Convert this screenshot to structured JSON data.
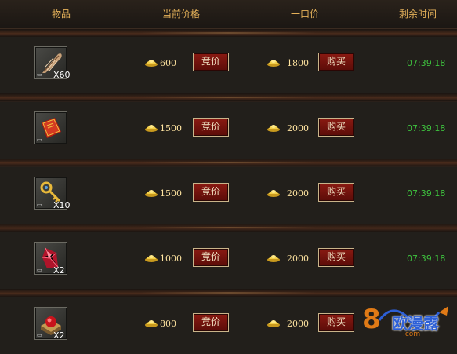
{
  "header": {
    "item": "物品",
    "current_price": "当前价格",
    "buyout_price": "一口价",
    "time_left": "剩余时间"
  },
  "buttons": {
    "bid": "竞价",
    "buy": "购买"
  },
  "rows": [
    {
      "icon": "feather-icon",
      "qty": "X60",
      "current_price": "600",
      "buyout_price": "1800",
      "time_left": "07:39:18"
    },
    {
      "icon": "red-book-icon",
      "qty": "",
      "current_price": "1500",
      "buyout_price": "2000",
      "time_left": "07:39:18"
    },
    {
      "icon": "golden-key-icon",
      "qty": "X10",
      "current_price": "1500",
      "buyout_price": "2000",
      "time_left": "07:39:18"
    },
    {
      "icon": "red-crystal-icon",
      "qty": "X2",
      "current_price": "1000",
      "buyout_price": "2000",
      "time_left": "07:39:18"
    },
    {
      "icon": "red-gem-box-icon",
      "qty": "X2",
      "current_price": "800",
      "buyout_price": "2000",
      "time_left": ""
    }
  ],
  "watermark": {
    "text": "欧漫露",
    "sub": ".com",
    "num": "8"
  },
  "colors": {
    "header_text": "#e6b25a",
    "timer": "#3ec23e",
    "button_bg": "#8a1a12",
    "price_text": "#ffe4a0"
  }
}
